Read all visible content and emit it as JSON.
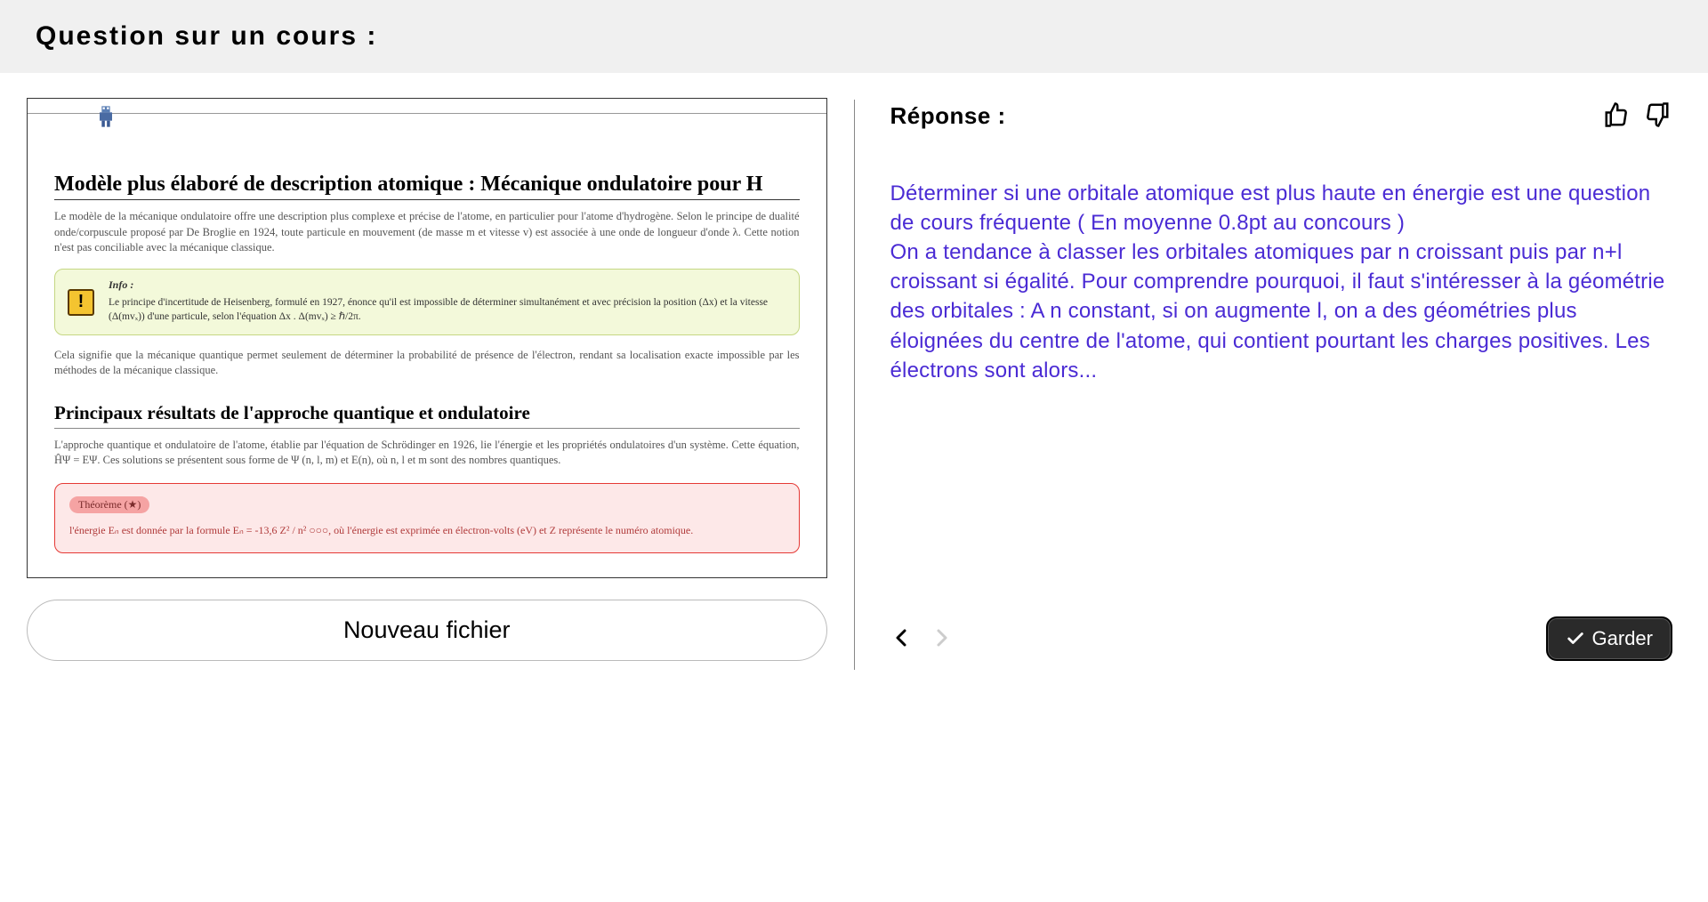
{
  "header": {
    "title": "Question sur un cours :"
  },
  "document": {
    "heading1": "Modèle plus élaboré de description atomique : Mécanique ondulatoire pour H",
    "para1": "Le modèle de la mécanique ondulatoire offre une description plus complexe et précise de l'atome, en particulier pour l'atome d'hydrogène. Selon le principe de dualité onde/corpuscule proposé par De Broglie en 1924, toute particule en mouvement (de masse m et vitesse v) est associée à une onde de longueur d'onde λ. Cette notion n'est pas conciliable avec la mécanique classique.",
    "info_label": "Info :",
    "info_text": "Le principe d'incertitude de Heisenberg, formulé en 1927, énonce qu'il est impossible de déterminer simultanément et avec précision la position (Δx) et la vitesse (Δ(mvₓ)) d'une particule, selon l'équation Δx . Δ(mvₓ) ≥ ℏ/2π.",
    "para2": "Cela signifie que la mécanique quantique permet seulement de déterminer la probabilité de présence de l'électron, rendant sa localisation exacte impossible par les méthodes de la mécanique classique.",
    "heading2": "Principaux résultats de l'approche quantique et ondulatoire",
    "para3": "L'approche quantique et ondulatoire de l'atome, établie par l'équation de Schrödinger en 1926, lie l'énergie et les propriétés ondulatoires d'un système. Cette équation, ĤΨ = EΨ. Ces solutions se présentent sous forme de Ψ (n, l, m) et E(n), où n, l et m sont des nombres quantiques.",
    "theorem_badge": "Théorème (★)",
    "theorem_text": "l'énergie Eₙ est donnée par la formule Eₙ = -13,6 Z² / n² ○○○, où l'énergie est exprimée en électron-volts (eV) et Z représente le numéro atomique."
  },
  "buttons": {
    "new_file": "Nouveau fichier",
    "keep": "Garder"
  },
  "response": {
    "title": "Réponse :",
    "body": "Déterminer si une orbitale atomique est plus haute en énergie  est une question de cours fréquente ( En moyenne 0.8pt au concours )\nOn a tendance à classer les orbitales atomiques par n croissant puis par n+l croissant si égalité. Pour comprendre pourquoi, il faut s'intéresser à la géométrie des orbitales : A n constant, si on augmente l, on a des géométries plus éloignées du centre de l'atome, qui contient pourtant les charges positives. Les électrons sont alors..."
  }
}
